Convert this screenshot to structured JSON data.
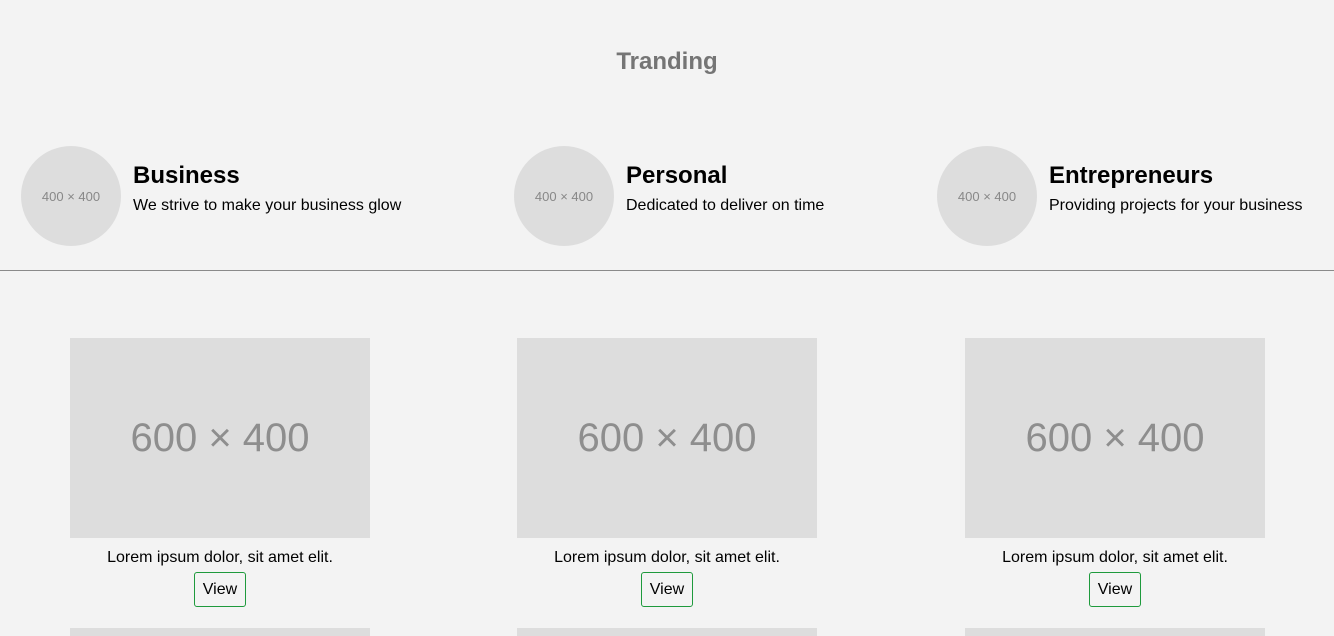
{
  "trending": {
    "title": "Tranding",
    "categories": [
      {
        "image_label": "400 × 400",
        "title": "Business",
        "description": "We strive to make your business glow"
      },
      {
        "image_label": "400 × 400",
        "title": "Personal",
        "description": "Dedicated to deliver on time"
      },
      {
        "image_label": "400 × 400",
        "title": "Entrepreneurs",
        "description": "Providing projects for your business"
      }
    ]
  },
  "cards": [
    {
      "image_label": "600 × 400",
      "caption": "Lorem ipsum dolor, sit amet elit.",
      "button_label": "View"
    },
    {
      "image_label": "600 × 400",
      "caption": "Lorem ipsum dolor, sit amet elit.",
      "button_label": "View"
    },
    {
      "image_label": "600 × 400",
      "caption": "Lorem ipsum dolor, sit amet elit.",
      "button_label": "View"
    }
  ],
  "colors": {
    "background": "#f3f3f3",
    "placeholder": "#dddddd",
    "title_gray": "#757575",
    "button_border": "#1e9a3c"
  }
}
